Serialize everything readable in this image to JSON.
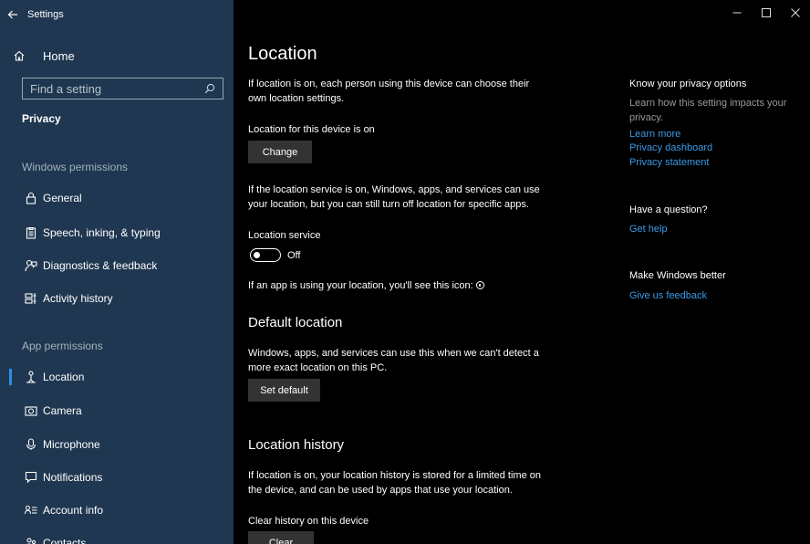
{
  "window": {
    "title": "Settings",
    "controls": [
      "–",
      "□",
      "✕"
    ]
  },
  "sidebar": {
    "home_label": "Home",
    "search_placeholder": "Find a setting",
    "section_title": "Privacy",
    "windows_permissions_header": "Windows permissions",
    "windows_permissions": [
      {
        "label": "General",
        "icon": "lock-icon"
      },
      {
        "label": "Speech, inking, & typing",
        "icon": "clipboard-icon"
      },
      {
        "label": "Diagnostics & feedback",
        "icon": "feedback-person-icon"
      },
      {
        "label": "Activity history",
        "icon": "timeline-icon"
      }
    ],
    "app_permissions_header": "App permissions",
    "app_permissions": [
      {
        "label": "Location",
        "icon": "location-person-icon",
        "active": true
      },
      {
        "label": "Camera",
        "icon": "camera-icon"
      },
      {
        "label": "Microphone",
        "icon": "microphone-icon"
      },
      {
        "label": "Notifications",
        "icon": "chat-bubble-icon"
      },
      {
        "label": "Account info",
        "icon": "account-info-icon"
      },
      {
        "label": "Contacts",
        "icon": "contacts-icon"
      }
    ],
    "accent_color": "#2a8fe6",
    "background_color": "#1f3750"
  },
  "main": {
    "title": "Location",
    "intro_line1": "If location is on, each person using this device can choose their",
    "intro_line2": "own location settings.",
    "device_status": "Location for this device is on",
    "change_button": "Change",
    "service_info_line1": "If the location service is on, Windows, apps, and services can use",
    "service_info_line2": "your location, but you can still turn off location for specific apps.",
    "service_label": "Location service",
    "toggle_state": "Off",
    "app_icon_note": "If an app is using your location, you'll see this icon:",
    "default_location": {
      "heading": "Default location",
      "line1": "Windows, apps, and services can use this when we can't detect a",
      "line2": "more exact location on this PC.",
      "button": "Set default"
    },
    "location_history": {
      "heading": "Location history",
      "line1": "If location is on, your location history is stored for a limited time on",
      "line2": "the device, and can be used by apps that use your location.",
      "clear_label": "Clear history on this device",
      "button": "Clear"
    }
  },
  "side": {
    "privacy_heading": "Know your privacy options",
    "privacy_text_line1": "Learn how this setting impacts your",
    "privacy_text_line2": "privacy.",
    "links": [
      "Learn more",
      "Privacy dashboard",
      "Privacy statement"
    ],
    "question_heading": "Have a question?",
    "get_help": "Get help",
    "better_heading": "Make Windows better",
    "feedback": "Give us feedback",
    "link_color": "#3b9ae6"
  }
}
